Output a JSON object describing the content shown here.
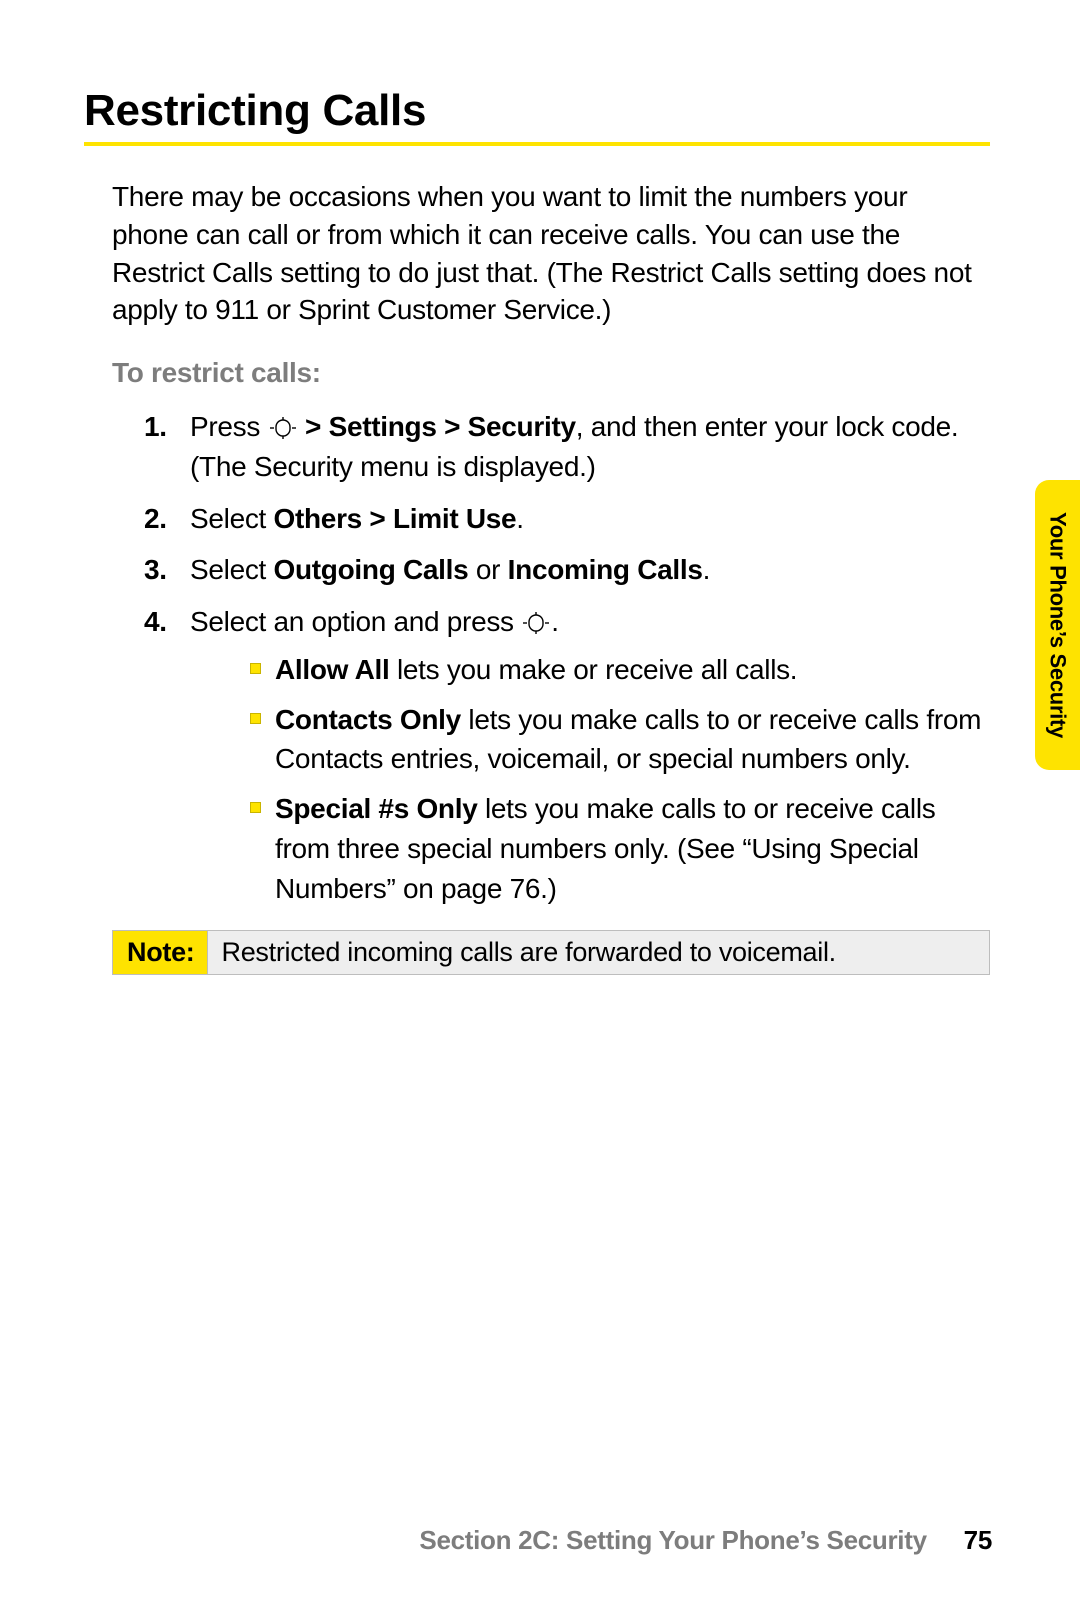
{
  "title": "Restricting Calls",
  "intro": "There may be occasions when you want to limit the numbers your phone can call or from which it can receive calls. You can use the Restrict Calls setting to do just that. (The Restrict Calls setting does not apply to 911 or Sprint Customer Service.)",
  "subhead": "To restrict calls:",
  "steps": {
    "n1": "1.",
    "s1a": "Press ",
    "s1b": " > Settings > Security",
    "s1c": ", and then enter your lock code. (The Security menu is displayed.)",
    "n2": "2.",
    "s2a": "Select ",
    "s2b": "Others > Limit Use",
    "s2c": ".",
    "n3": "3.",
    "s3a": "Select ",
    "s3b": "Outgoing Calls",
    "s3c": " or ",
    "s3d": "Incoming Calls",
    "s3e": ".",
    "n4": "4.",
    "s4a": "Select an option and press ",
    "s4b": "."
  },
  "bullets": {
    "b1a": "Allow All",
    "b1b": " lets you make or receive all calls.",
    "b2a": "Contacts Only",
    "b2b": " lets you make calls to or receive calls from Contacts entries, voicemail, or special numbers only.",
    "b3a": "Special #s Only",
    "b3b": " lets you make calls to or receive calls from three special numbers only. (See “Using Special Numbers” on page 76.)"
  },
  "note": {
    "label": "Note:",
    "text": "Restricted incoming calls are forwarded to voicemail."
  },
  "tab": "Your Phone’s Security",
  "footer": {
    "section": "Section 2C: Setting Your Phone’s Security",
    "page": "75"
  }
}
